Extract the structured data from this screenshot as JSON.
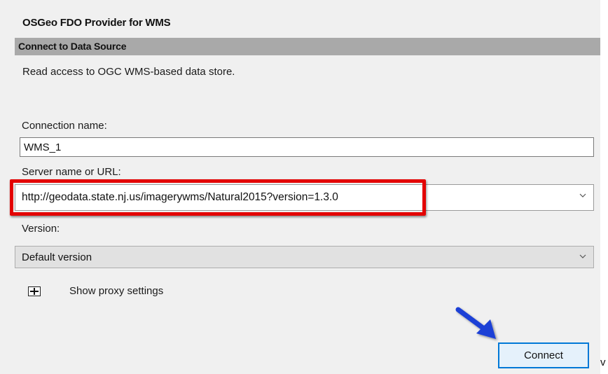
{
  "provider_title": "OSGeo FDO Provider for WMS",
  "section": {
    "title": "Connect to Data Source",
    "description": "Read access to OGC WMS-based data store."
  },
  "fields": {
    "connection_name": {
      "label": "Connection name:",
      "value": "WMS_1"
    },
    "server": {
      "label": "Server name or URL:",
      "value": "http://geodata.state.nj.us/imagerywms/Natural2015?version=1.3.0"
    },
    "version": {
      "label": "Version:",
      "value": "Default version"
    }
  },
  "proxy": {
    "label": "Show proxy settings"
  },
  "buttons": {
    "connect": "Connect"
  },
  "edge_text": "v",
  "colors": {
    "highlight_box": "#e30000",
    "arrow": "#1a3fd6",
    "button_border": "#0078d7",
    "section_bar": "#a9a9a9"
  },
  "icons": {
    "dropdown": "chevron-down-icon",
    "expand": "plus-box-icon",
    "annotation": "arrow-annotation"
  }
}
